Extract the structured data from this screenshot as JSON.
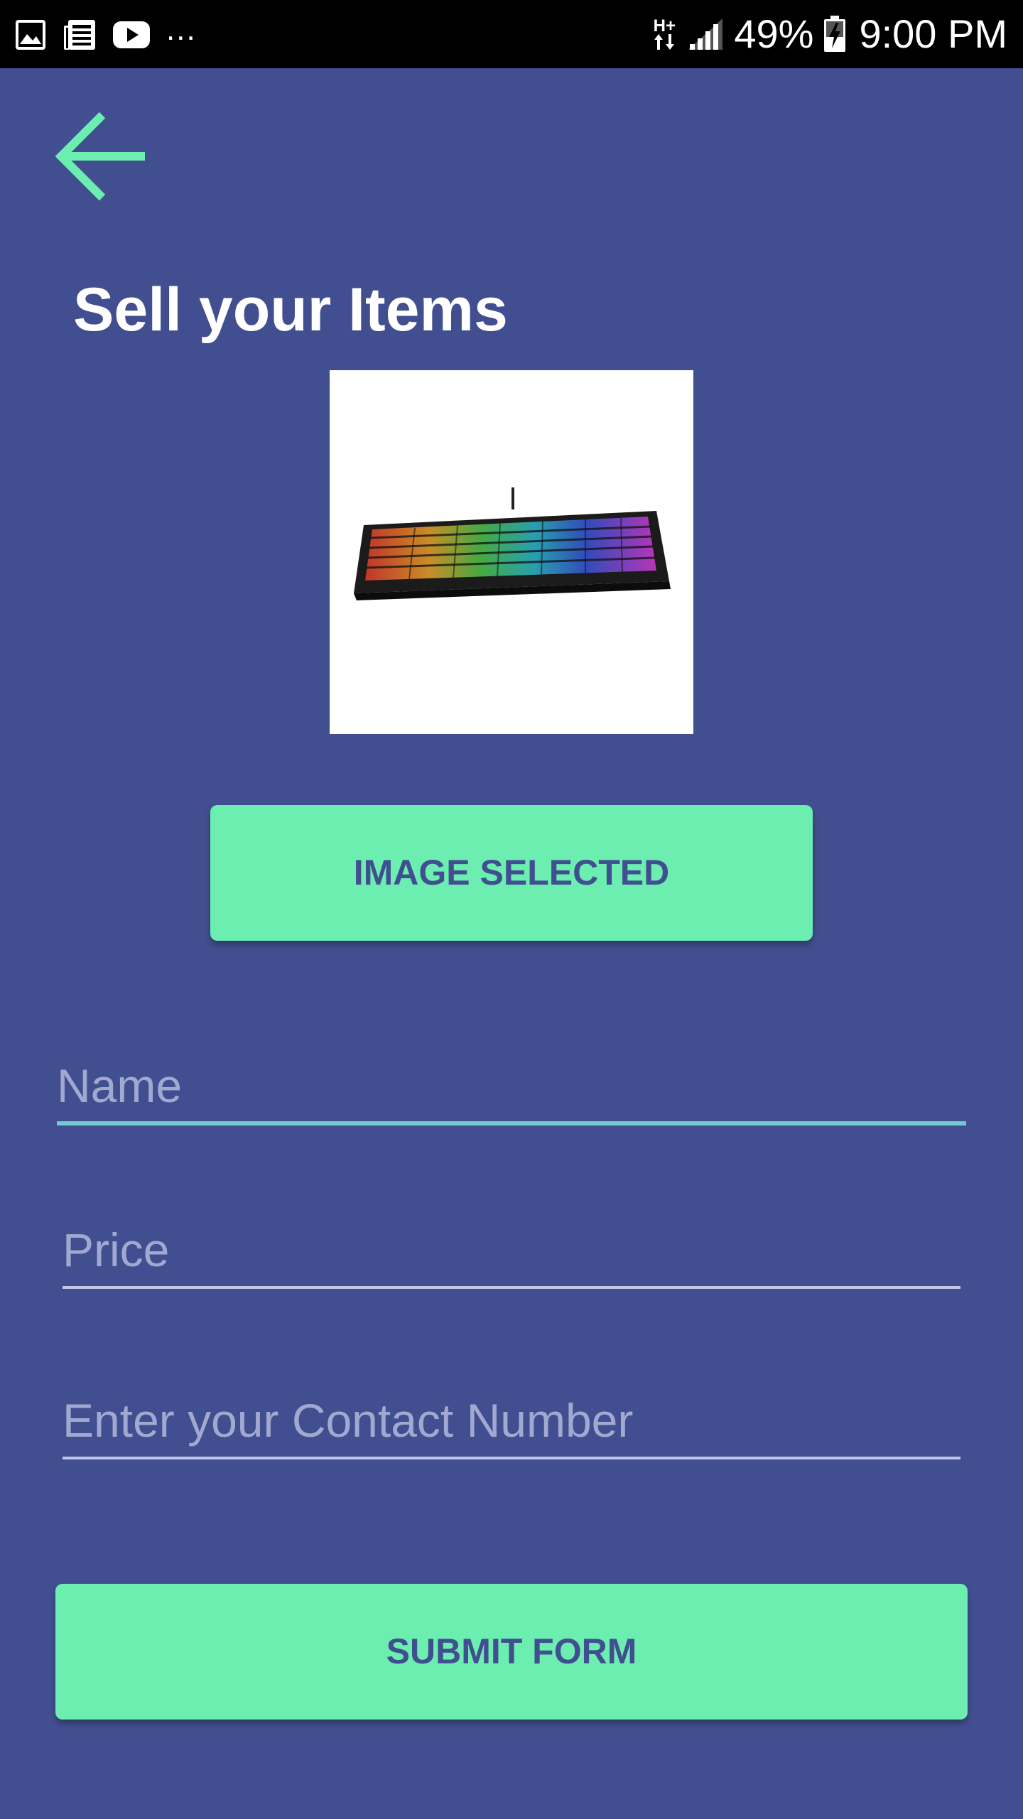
{
  "status_bar": {
    "battery_percent": "49%",
    "time": "9:00 PM",
    "network_type": "H+",
    "overflow": "...",
    "icons": [
      "gallery-icon",
      "news-icon",
      "youtube-icon",
      "data-transfer-icon",
      "signal-icon",
      "battery-charging-icon"
    ]
  },
  "header": {
    "back_icon": "arrow-left-icon",
    "title": "Sell your Items"
  },
  "image_preview": {
    "subject": "keyboard-image"
  },
  "buttons": {
    "image_selected_label": "IMAGE SELECTED",
    "submit_label": "SUBMIT FORM"
  },
  "form": {
    "name": {
      "value": "",
      "placeholder": "Name"
    },
    "price": {
      "value": "",
      "placeholder": "Price"
    },
    "contact": {
      "value": "",
      "placeholder": "Enter your Contact Number"
    }
  },
  "colors": {
    "background": "#414f90",
    "accent": "#6beeb0",
    "focused_underline": "#72c9cf",
    "placeholder": "#a2a9d1"
  }
}
